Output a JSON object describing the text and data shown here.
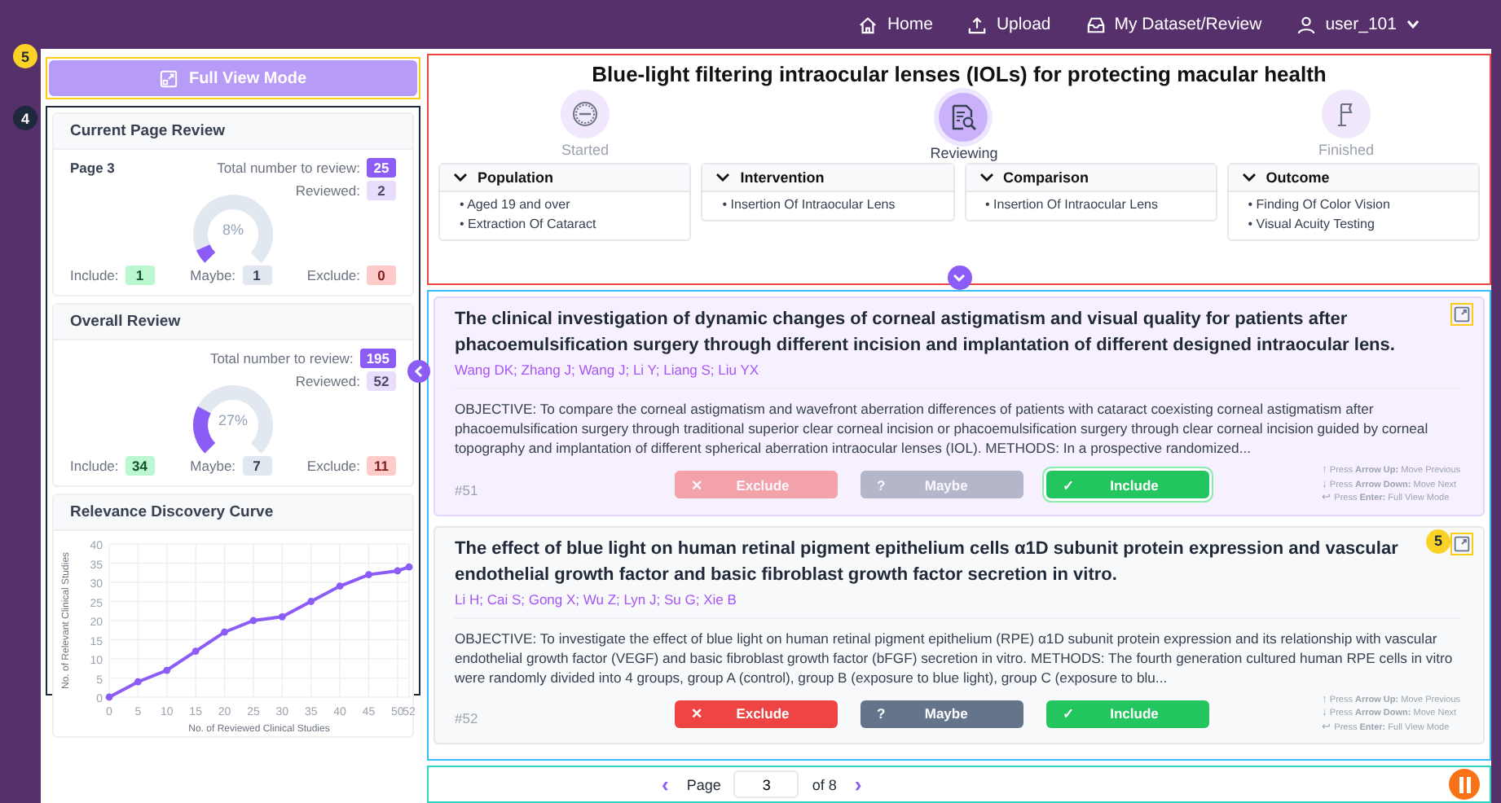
{
  "nav": [
    {
      "kind": "home",
      "label": "Home"
    },
    {
      "kind": "upload",
      "label": "Upload"
    },
    {
      "kind": "inbox",
      "label": "My Dataset/Review"
    },
    {
      "kind": "user",
      "label": "user_101"
    }
  ],
  "guide_badges": {
    "full_view": "5",
    "stats": "4",
    "card": "5"
  },
  "full_view_button": "Full View Mode",
  "current_page_review": {
    "title": "Current Page Review",
    "page": "Page 3",
    "total_label": "Total number to review:",
    "total": "25",
    "reviewed_label": "Reviewed:",
    "reviewed": "2",
    "level": 0.08,
    "percent": "8%",
    "include_label": "Include:",
    "include": "1",
    "maybe_label": "Maybe:",
    "maybe": "1",
    "exclude_label": "Exclude:",
    "exclude": "0"
  },
  "overall_review": {
    "title": "Overall Review",
    "total_label": "Total number to review:",
    "total": "195",
    "reviewed_label": "Reviewed:",
    "reviewed": "52",
    "level": 0.27,
    "percent": "27%",
    "include_label": "Include:",
    "include": "34",
    "maybe_label": "Maybe:",
    "maybe": "7",
    "exclude_label": "Exclude:",
    "exclude": "11"
  },
  "curve": {
    "title": "Relevance Discovery Curve",
    "chart_data": {
      "type": "line",
      "xlabel": "No. of Reviewed Clinical Studies",
      "ylabel": "No. of Relevant Clinical Studies",
      "x": [
        0,
        5,
        10,
        15,
        20,
        25,
        30,
        35,
        40,
        45,
        50,
        52
      ],
      "grid": true,
      "series": [
        {
          "color": "#8b5cf6",
          "marker": true,
          "values": [
            0,
            4,
            7,
            12,
            17,
            20,
            21,
            25,
            29,
            32,
            33,
            34
          ]
        }
      ],
      "xlim": [
        0,
        52
      ],
      "ylim": [
        0,
        40
      ],
      "xticks": [
        0,
        5,
        10,
        15,
        20,
        25,
        30,
        35,
        40,
        45,
        50,
        52
      ],
      "yticks": [
        0,
        5,
        10,
        15,
        20,
        25,
        30,
        35,
        40
      ]
    }
  },
  "review_title": "Blue-light filtering intraocular lenses (IOLs) for protecting macular health",
  "steps": [
    {
      "kind": "start",
      "label": "Started",
      "selected": false
    },
    {
      "kind": "review",
      "label": "Reviewing",
      "selected": true
    },
    {
      "kind": "finish",
      "label": "Finished",
      "selected": false
    }
  ],
  "pico": [
    {
      "title": "Population",
      "expanded": true,
      "items": [
        "• Aged 19 and over",
        "• Extraction Of Cataract"
      ]
    },
    {
      "title": "Intervention",
      "expanded": true,
      "items": [
        "• Insertion Of Intraocular Lens"
      ]
    },
    {
      "title": "Comparison",
      "expanded": true,
      "items": [
        "• Insertion Of Intraocular Lens"
      ]
    },
    {
      "title": "Outcome",
      "expanded": true,
      "items": [
        "• Finding Of Color Vision",
        "• Visual Acuity Testing"
      ]
    }
  ],
  "studies": [
    {
      "selected": true,
      "title": "The clinical investigation of dynamic changes of corneal astigmatism and visual quality for patients after phacoemulsification surgery through different incision and implantation of different designed intraocular lens.",
      "authors": "Wang DK; Zhang J; Wang J; Li Y; Liang S; Liu YX",
      "abstract": "OBJECTIVE: To compare the corneal astigmatism and wavefront aberration differences of patients with cataract coexisting corneal astigmatism after phacoemulsification surgery through traditional superior clear corneal incision or phacoemulsification surgery through clear corneal incision guided by corneal topography and implantation of different spherical aberration intraocular lenses (IOL). METHODS: In a prospective randomized...",
      "number": "#51",
      "decided": true,
      "buttons": [
        {
          "kind": "exclude",
          "glyph": "✕",
          "label": "Exclude",
          "selected": false
        },
        {
          "kind": "maybe",
          "glyph": "?",
          "label": "Maybe",
          "selected": false
        },
        {
          "kind": "include",
          "glyph": "✓",
          "label": "Include",
          "selected": true
        }
      ],
      "shortcuts": [
        {
          "glyph": "↑",
          "text": "Press **Arrow Up:** Move Previous"
        },
        {
          "glyph": "↓",
          "text": "Press **Arrow Down:** Move Next"
        },
        {
          "glyph": "↩",
          "text": "Press **Enter:** Full View Mode"
        }
      ]
    },
    {
      "selected": false,
      "title": "The effect of blue light on human retinal pigment epithelium cells α1D subunit protein expression and vascular endothelial growth factor and basic fibroblast growth factor secretion in vitro.",
      "authors": "Li H; Cai S; Gong X; Wu Z; Lyn J; Su G; Xie B",
      "abstract": "OBJECTIVE: To investigate the effect of blue light on human retinal pigment epithelium (RPE) α1D subunit protein expression and its relationship with vascular endothelial growth factor (VEGF) and basic fibroblast growth factor (bFGF) secretion in vitro. METHODS: The fourth generation cultured human RPE cells in vitro were randomly divided into 4 groups, group A (control), group B (exposure to blue light), group C (exposure to blu...",
      "number": "#52",
      "decided": false,
      "buttons": [
        {
          "kind": "exclude",
          "glyph": "✕",
          "label": "Exclude",
          "selected": false
        },
        {
          "kind": "maybe",
          "glyph": "?",
          "label": "Maybe",
          "selected": false
        },
        {
          "kind": "include",
          "glyph": "✓",
          "label": "Include",
          "selected": false
        }
      ],
      "shortcuts": [
        {
          "glyph": "↑",
          "text": "Press **Arrow Up:** Move Previous"
        },
        {
          "glyph": "↓",
          "text": "Press **Arrow Down:** Move Next"
        },
        {
          "glyph": "↩",
          "text": "Press **Enter:** Full View Mode"
        }
      ]
    }
  ],
  "pagination": {
    "prev": "‹",
    "label": "Page",
    "value": "3",
    "of": "of 8",
    "next": "›"
  }
}
